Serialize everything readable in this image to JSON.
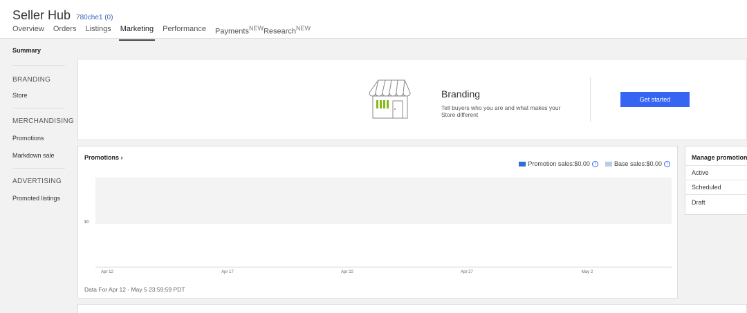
{
  "header": {
    "title": "Seller Hub",
    "user": "780che1 (0)",
    "tabs": [
      {
        "label": "Overview"
      },
      {
        "label": "Orders"
      },
      {
        "label": "Listings"
      },
      {
        "label": "Marketing"
      },
      {
        "label": "Performance"
      },
      {
        "label": "Payments",
        "badge": "NEW"
      },
      {
        "label": "Research",
        "badge": "NEW"
      }
    ],
    "active_tab": "Marketing"
  },
  "sidebar": {
    "summary": "Summary",
    "branding_heading": "BRANDING",
    "store": "Store",
    "merchandising_heading": "MERCHANDISING",
    "promotions": "Promotions",
    "markdown_sale": "Markdown sale",
    "advertising_heading": "ADVERTISING",
    "promoted_listings": "Promoted listings"
  },
  "branding": {
    "title": "Branding",
    "description": "Tell buyers who you are and what makes your Store different",
    "cta": "Get started",
    "icon": "storefront-icon"
  },
  "promotions_panel": {
    "title": "Promotions",
    "legend": {
      "promotion_sales": "Promotion sales:$0.00",
      "base_sales": "Base sales:$0.00"
    },
    "data_range": "Data For Apr 12 - May 5 23:59:59 PDT"
  },
  "manage": {
    "title": "Manage promotions",
    "items": [
      "Active",
      "Scheduled",
      "Draft"
    ]
  },
  "colors": {
    "accent": "#3665f3",
    "link": "#3665b3",
    "promotion_series": "#2f6fd1",
    "base_series": "#b9cde8",
    "plot_bg": "#f3f3f3"
  },
  "chart_data": {
    "type": "line",
    "x": [
      "Apr 12",
      "Apr 17",
      "Apr 22",
      "Apr 27",
      "May 2"
    ],
    "y_ticks": [
      "$0"
    ],
    "series": [
      {
        "name": "Promotion sales",
        "values": [
          0,
          0,
          0,
          0,
          0
        ]
      },
      {
        "name": "Base sales",
        "values": [
          0,
          0,
          0,
          0,
          0
        ]
      }
    ],
    "legend": "top-right",
    "grid": false
  }
}
